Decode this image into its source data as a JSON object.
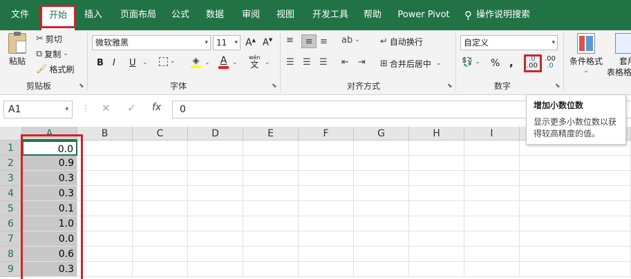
{
  "tabs": [
    "文件",
    "开始",
    "插入",
    "页面布局",
    "公式",
    "数据",
    "审阅",
    "视图",
    "开发工具",
    "帮助",
    "Power Pivot"
  ],
  "search_label": "操作说明搜索",
  "clipboard": {
    "paste": "粘贴",
    "cut": "剪切",
    "copy": "复制",
    "format_painter": "格式刷",
    "group": "剪贴板"
  },
  "font": {
    "name": "微软雅黑",
    "size": "11",
    "group": "字体",
    "bold": "B",
    "italic": "I",
    "underline": "U",
    "phonetic_small": "wén",
    "phonetic_big": "文"
  },
  "alignment": {
    "wrap": "自动换行",
    "merge": "合并后居中",
    "group": "对齐方式"
  },
  "number": {
    "format": "自定义",
    "percent": "%",
    "comma": ",",
    "group": "数字",
    "inc_top": ".0",
    "inc_bottom": ".00",
    "dec_top": ".00",
    "dec_bottom": ".0"
  },
  "styles": {
    "conditional": "条件格式",
    "table_top": "套用",
    "table_bottom": "表格格"
  },
  "formula_bar": {
    "name_box": "A1",
    "cancel": "✕",
    "enter": "✓",
    "fx": "fx",
    "value": "0"
  },
  "columns": [
    "A",
    "B",
    "C",
    "D",
    "E",
    "F",
    "G",
    "H",
    "I"
  ],
  "rows": [
    "1",
    "2",
    "3",
    "4",
    "5",
    "6",
    "7",
    "8",
    "9"
  ],
  "column_a": [
    "0.0",
    "0.9",
    "0.3",
    "0.3",
    "0.1",
    "1.0",
    "0.0",
    "0.6",
    "0.3"
  ],
  "tooltip": {
    "title": "增加小数位数",
    "body": "显示更多小数位数以获得较高精度的值。"
  },
  "colors": {
    "excel_green": "#217346",
    "highlight_red": "#d42027"
  }
}
